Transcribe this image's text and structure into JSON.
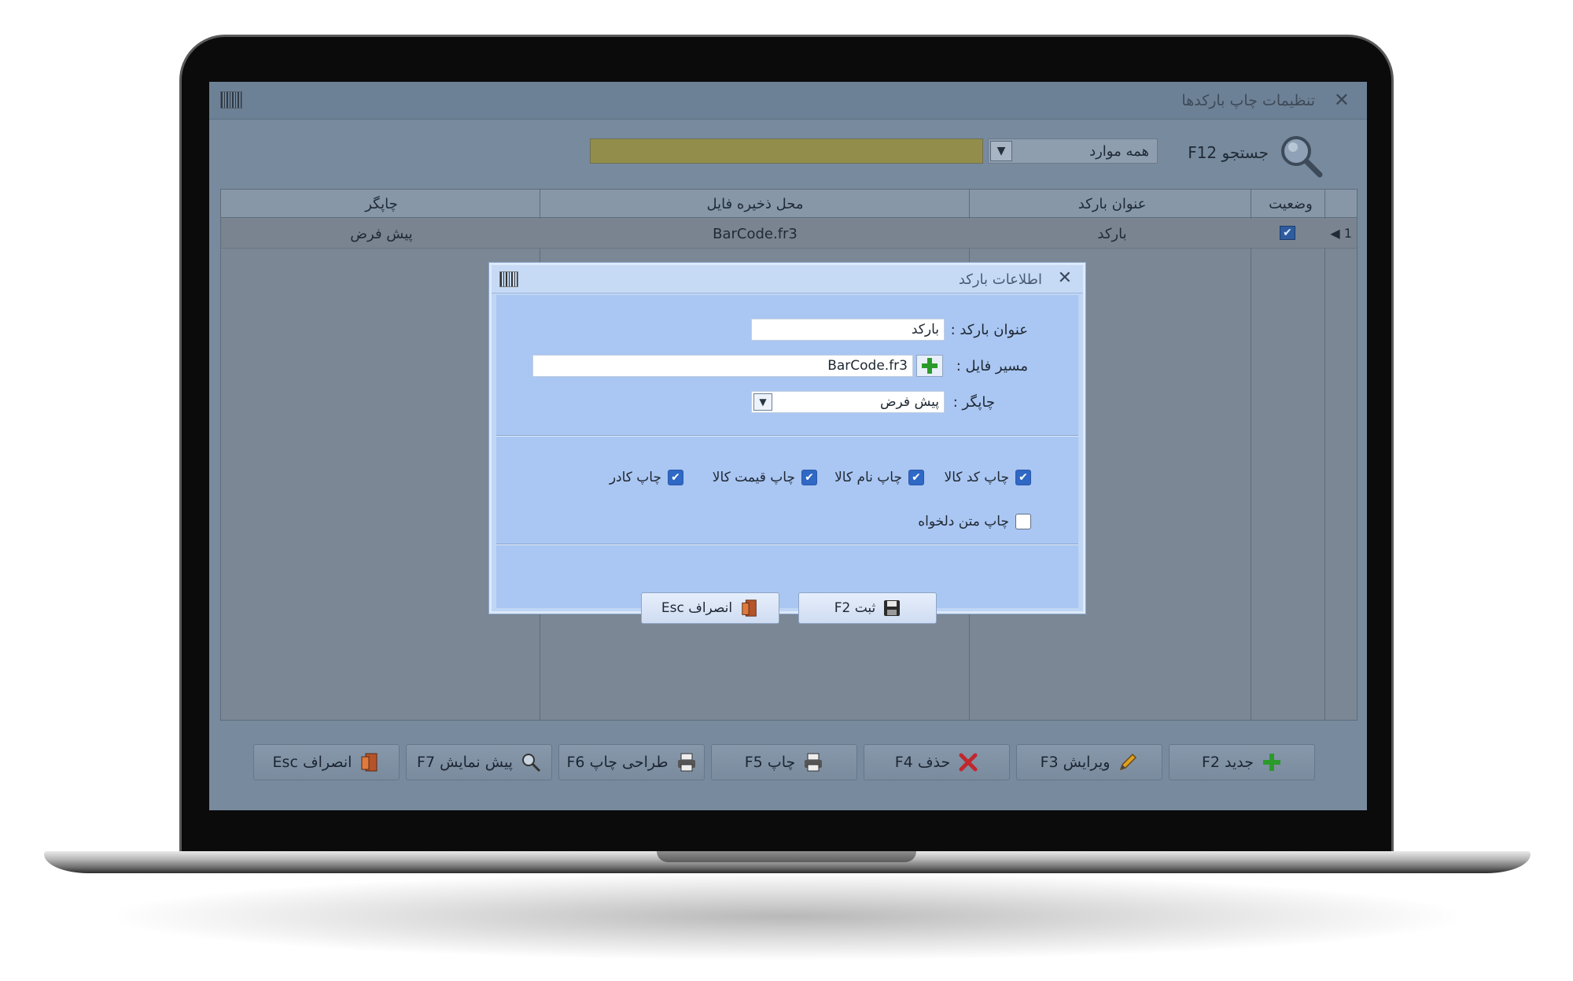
{
  "window": {
    "title": "تنظیمات چاپ بارکدها",
    "close": "✕"
  },
  "search": {
    "label": "جستجو F12",
    "filter_value": "همه موارد",
    "input_value": ""
  },
  "grid": {
    "columns": [
      "وضعیت",
      "عنوان بارکد",
      "محل ذخیره فایل",
      "چاپگر"
    ],
    "rows": [
      {
        "index": "1",
        "status_checked": true,
        "title": "بارکد",
        "file": "BarCode.fr3",
        "printer": "پیش فرض"
      }
    ]
  },
  "toolbar": {
    "new": "جدید F2",
    "edit": "ویرایش F3",
    "delete": "حذف F4",
    "print": "چاپ F5",
    "design": "طراحی چاپ F6",
    "preview": "پیش نمایش F7",
    "cancel": "انصراف Esc"
  },
  "dialog": {
    "title": "اطلاعات بارکد",
    "close": "✕",
    "title_label": "عنوان بارکد :",
    "title_value": "بارکد",
    "path_label": "مسیر فایل :",
    "path_value": "BarCode.fr3",
    "printer_label": "چاپگر :",
    "printer_value": "پیش فرض",
    "options": [
      {
        "label": "چاپ کد کالا",
        "checked": true
      },
      {
        "label": "چاپ نام کالا",
        "checked": true
      },
      {
        "label": "چاپ قیمت کالا",
        "checked": true
      },
      {
        "label": "چاپ کادر",
        "checked": true
      },
      {
        "label": "چاپ متن دلخواه",
        "checked": false
      }
    ],
    "save": "ثبت F2",
    "cancel": "انصراف Esc"
  },
  "colors": {
    "screen_bg": "#778a9e",
    "dialog_bg": "#aac6f2",
    "search_input": "#928d4a",
    "check_blue": "#2f68c5"
  }
}
